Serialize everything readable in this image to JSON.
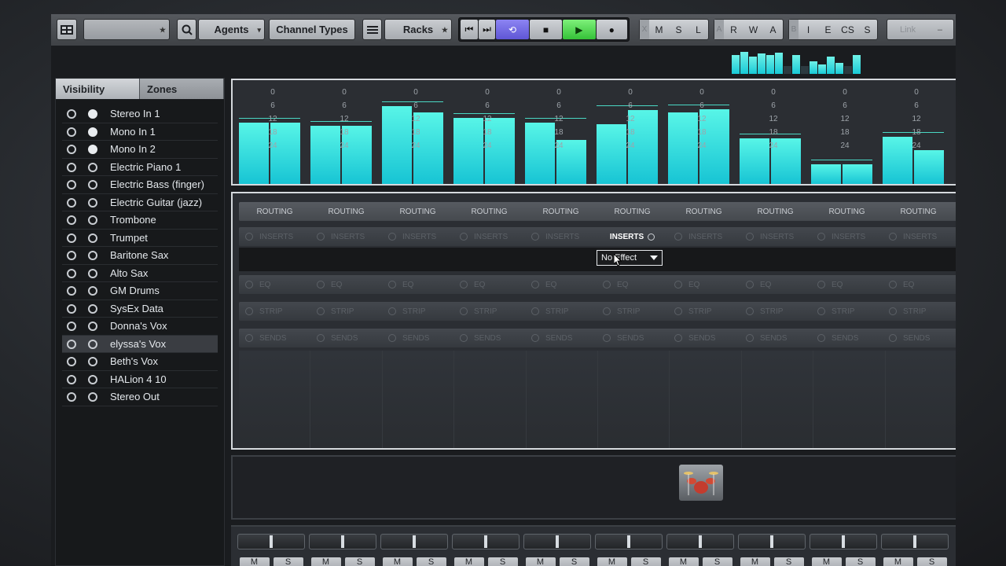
{
  "toolbar": {
    "agents_label": "Agents",
    "channel_types_label": "Channel Types",
    "racks_label": "Racks",
    "mix_group": [
      "X",
      "M",
      "S",
      "L"
    ],
    "automation_group": [
      "A",
      "R",
      "W",
      "A"
    ],
    "view_group": [
      "B",
      "I",
      "E",
      "CS",
      "S"
    ],
    "link_label": "Link"
  },
  "left_panel": {
    "tabs": [
      "Visibility",
      "Zones"
    ],
    "channels": [
      {
        "name": "Stereo In 1",
        "visible": true,
        "zone": true
      },
      {
        "name": "Mono In 1",
        "visible": true,
        "zone": true
      },
      {
        "name": "Mono In 2",
        "visible": true,
        "zone": true
      },
      {
        "name": "Electric Piano 1",
        "visible": true,
        "zone": false
      },
      {
        "name": "Electric Bass (finger)",
        "visible": true,
        "zone": false
      },
      {
        "name": "Electric Guitar (jazz)",
        "visible": true,
        "zone": false
      },
      {
        "name": "Trombone",
        "visible": true,
        "zone": false
      },
      {
        "name": "Trumpet",
        "visible": true,
        "zone": false
      },
      {
        "name": "Baritone Sax",
        "visible": true,
        "zone": false
      },
      {
        "name": "Alto Sax",
        "visible": true,
        "zone": false
      },
      {
        "name": "GM Drums",
        "visible": true,
        "zone": false
      },
      {
        "name": "SysEx Data",
        "visible": true,
        "zone": false
      },
      {
        "name": "Donna's Vox",
        "visible": true,
        "zone": false
      },
      {
        "name": "elyssa's Vox",
        "visible": true,
        "zone": false,
        "selected": true
      },
      {
        "name": "Beth's Vox",
        "visible": true,
        "zone": false
      },
      {
        "name": "HALion 4 10",
        "visible": true,
        "zone": false
      },
      {
        "name": "Stereo Out",
        "visible": true,
        "zone": false
      }
    ]
  },
  "meters": {
    "scale_labels": [
      "0",
      "6",
      "12",
      "18",
      "24"
    ],
    "levels": [
      [
        0.7,
        0.7
      ],
      [
        0.66,
        0.66
      ],
      [
        0.88,
        0.81
      ],
      [
        0.75,
        0.75
      ],
      [
        0.7,
        0.5
      ],
      [
        0.68,
        0.84
      ],
      [
        0.81,
        0.85
      ],
      [
        0.52,
        0.52
      ],
      [
        0.22,
        0.22
      ],
      [
        0.54,
        0.38
      ]
    ]
  },
  "rack": {
    "routing_label": "ROUTING",
    "inserts_label": "INSERTS",
    "eq_label": "EQ",
    "strip_label": "STRIP",
    "sends_label": "SENDS",
    "active_inserts_channel": 5,
    "insert_slot_value": "No Effect"
  },
  "faders": {
    "mute_label": "M",
    "solo_label": "S"
  }
}
